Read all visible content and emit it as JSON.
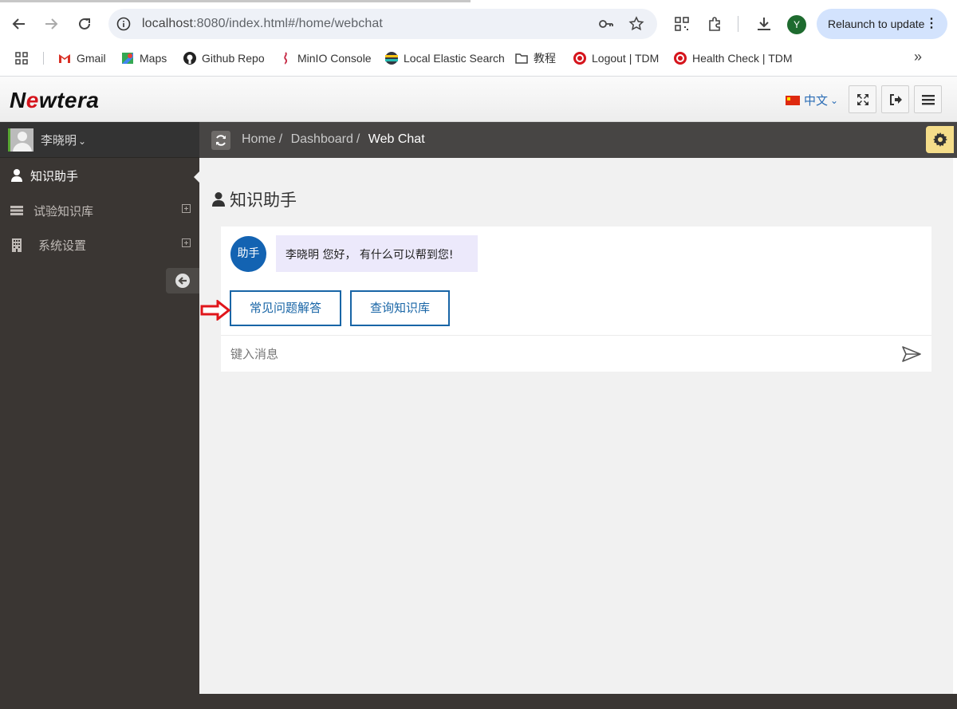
{
  "browser": {
    "url_host": "localhost",
    "url_rest": ":8080/index.html#/home/webchat",
    "profile_initial": "Y",
    "relaunch_label": "Relaunch to update",
    "more_label": "⋮",
    "bookmarks_more": "»",
    "bookmarks": [
      {
        "label": "Gmail",
        "icon": "gmail-icon"
      },
      {
        "label": "Maps",
        "icon": "maps-icon"
      },
      {
        "label": "Github Repo",
        "icon": "github-icon"
      },
      {
        "label": "MinIO Console",
        "icon": "minio-icon"
      },
      {
        "label": "Local Elastic Search",
        "icon": "elastic-icon"
      },
      {
        "label": "教程",
        "icon": "folder-icon"
      },
      {
        "label": "Logout | TDM",
        "icon": "tdm-icon"
      },
      {
        "label": "Health Check | TDM",
        "icon": "tdm-icon"
      }
    ]
  },
  "header": {
    "logo_pre": "N",
    "logo_e": "e",
    "logo_post": "wtera",
    "language": "中文",
    "language_caret": "⌄"
  },
  "sidebar": {
    "user_name": "李晓明",
    "user_caret": "⌄",
    "items": [
      {
        "label": "知识助手",
        "icon": "user-icon",
        "active": true
      },
      {
        "label": "试验知识库",
        "icon": "server-icon",
        "expandable": true
      },
      {
        "label": "系统设置",
        "icon": "building-icon",
        "expandable": true
      }
    ]
  },
  "breadcrumb": {
    "items": [
      "Home",
      "Dashboard",
      "Web Chat"
    ],
    "separator": "/"
  },
  "page": {
    "title": "知识助手"
  },
  "chat": {
    "bot_name": "助手",
    "greeting": "李晓明 您好，  有什么可以帮到您!",
    "quick_actions": [
      "常见问题解答",
      "查询知识库"
    ],
    "input_placeholder": "键入消息",
    "input_value": ""
  },
  "colors": {
    "sidebar_bg": "#3a3633",
    "ribbon_bg": "#474544",
    "accent_blue": "#1865a6",
    "bubble_bg": "#ece9fb",
    "gear_bg": "#f5dd8a",
    "annotation_red": "#e0161b"
  }
}
